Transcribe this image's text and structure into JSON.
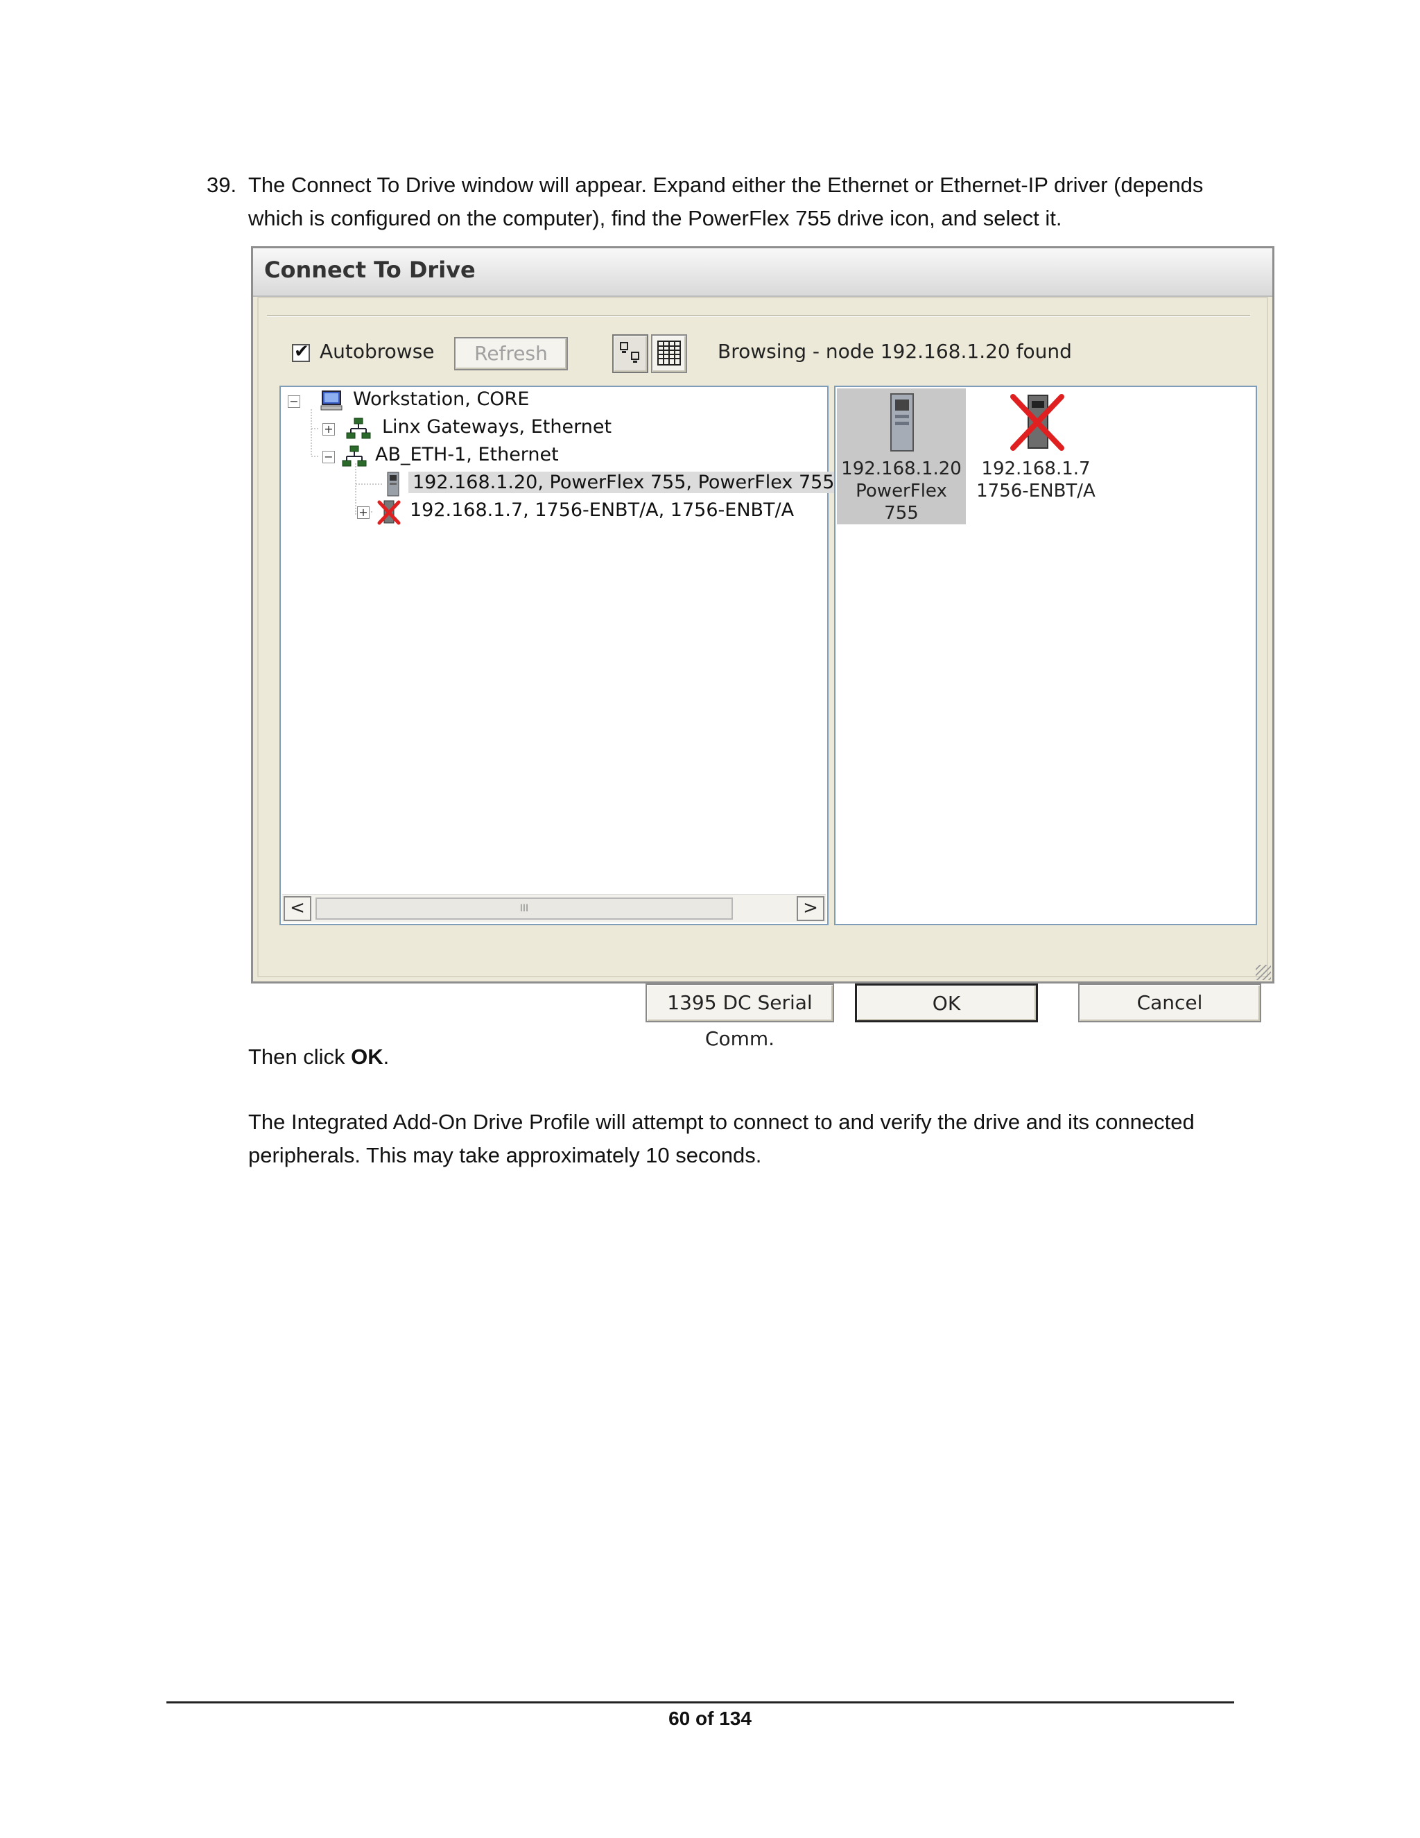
{
  "document": {
    "step_number": "39.",
    "step_text": "The Connect To Drive window will appear. Expand either the Ethernet or Ethernet-IP driver (depends which is configured on the computer), find the PowerFlex 755 drive icon, and select it.",
    "then_prefix": "Then click ",
    "then_bold": "OK",
    "then_suffix": ".",
    "paragraph": "The Integrated Add-On Drive Profile will attempt to connect to and verify the drive and its connected peripherals. This may take approximately 10 seconds.",
    "page_footer": "60 of 134"
  },
  "dialog": {
    "title": "Connect To Drive",
    "autobrowse_label": "Autobrowse",
    "autobrowse_checked": true,
    "refresh_label": "Refresh",
    "status_text": "Browsing - node 192.168.1.20 found",
    "tree": [
      {
        "label": "Workstation, CORE",
        "expander": "−",
        "icon": "workstation-icon"
      },
      {
        "label": "Linx Gateways, Ethernet",
        "expander": "+",
        "icon": "network-icon"
      },
      {
        "label": "AB_ETH-1, Ethernet",
        "expander": "−",
        "icon": "network-icon"
      },
      {
        "label": "192.168.1.20, PowerFlex 755, PowerFlex 755",
        "expander": "",
        "icon": "drive-icon",
        "selected": true
      },
      {
        "label": "192.168.1.7, 1756-ENBT/A, 1756-ENBT/A",
        "expander": "+",
        "icon": "error-device-icon"
      }
    ],
    "list_items": [
      {
        "line1": "192.168.1.20",
        "line2": "PowerFlex 755",
        "icon": "drive-icon",
        "selected": true
      },
      {
        "line1": "192.168.1.7",
        "line2": "1756-ENBT/A",
        "icon": "error-device-icon",
        "selected": false
      }
    ],
    "scroll_left": "<",
    "scroll_right": ">",
    "scroll_grip": "III",
    "buttons": {
      "serial": "1395 DC Serial Comm.",
      "ok": "OK",
      "cancel": "Cancel"
    }
  },
  "colors": {
    "dialog_bg": "#ece9d8",
    "selection": "#c8c8c8",
    "error_x": "#e02020"
  }
}
